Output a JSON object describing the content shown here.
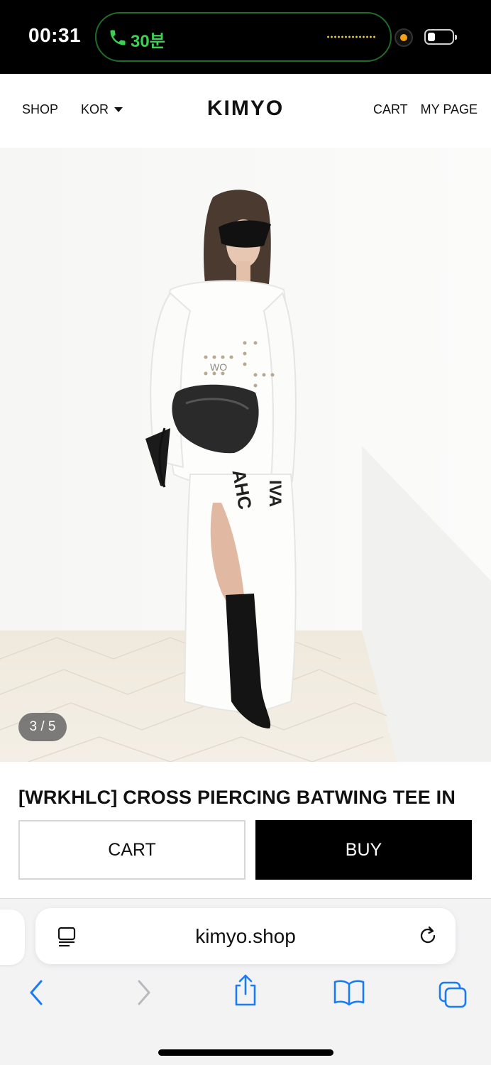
{
  "status_bar": {
    "time": "00:31",
    "call_duration": "30분"
  },
  "header": {
    "shop": "SHOP",
    "language": "KOR",
    "logo": "KIMYO",
    "cart": "CART",
    "my_page": "MY PAGE"
  },
  "gallery": {
    "counter": "3 / 5",
    "current_index": 3,
    "total": 5
  },
  "product": {
    "title": "[WRKHLC] CROSS PIERCING BATWING TEE IN"
  },
  "actions": {
    "cart_label": "CART",
    "buy_label": "BUY"
  },
  "browser": {
    "url": "kimyo.shop"
  },
  "icons": {
    "call": "phone-icon",
    "reader": "page-menu-icon",
    "reload": "reload-icon",
    "back": "chevron-left-icon",
    "forward": "chevron-right-icon",
    "share": "share-icon",
    "bookmarks": "book-icon",
    "tabs": "tabs-icon"
  },
  "colors": {
    "accent_blue": "#1a7cf5",
    "call_green": "#39d353",
    "buy_button": "#000000"
  }
}
